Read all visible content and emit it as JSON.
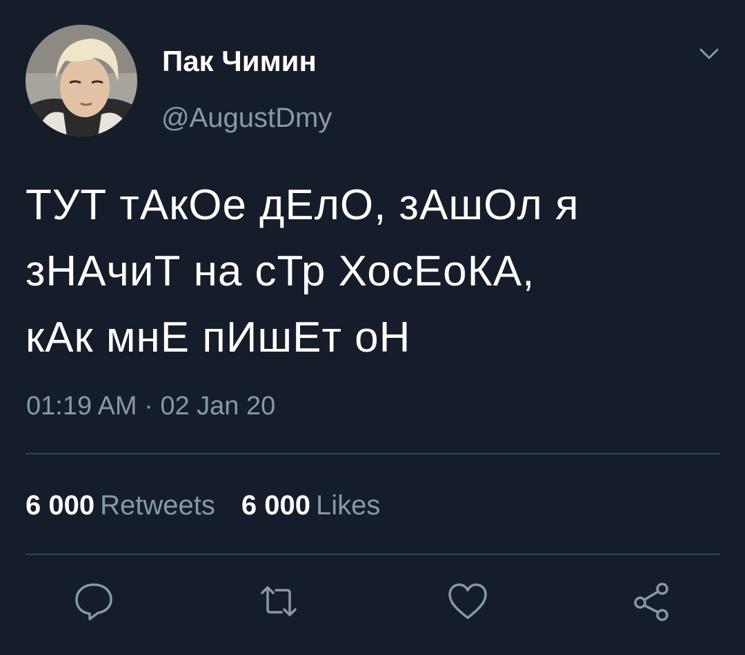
{
  "tweet": {
    "author": {
      "display_name": "Пак Чимин",
      "handle": "@AugustDmy",
      "avatar_icon": "profile-photo"
    },
    "text": "ТУТ тАкОе дЕлО, зАшОл я\nзНАчиТ на сТр ХосЕоКА,\nкАк мнЕ пИшЕт оН",
    "timestamp": "01:19 AM · 02 Jan 20",
    "stats": {
      "retweets_count": "6 000",
      "retweets_label": "Retweets",
      "likes_count": "6 000",
      "likes_label": "Likes"
    },
    "actions": [
      {
        "name": "reply",
        "icon": "reply-icon"
      },
      {
        "name": "retweet",
        "icon": "retweet-icon"
      },
      {
        "name": "like",
        "icon": "heart-icon"
      },
      {
        "name": "share",
        "icon": "share-icon"
      }
    ],
    "menu_icon": "chevron-down-icon"
  },
  "colors": {
    "background": "#161d2a",
    "text_primary": "#ffffff",
    "text_secondary": "#8899a6",
    "divider": "#38444d",
    "icon": "#8899a6"
  }
}
